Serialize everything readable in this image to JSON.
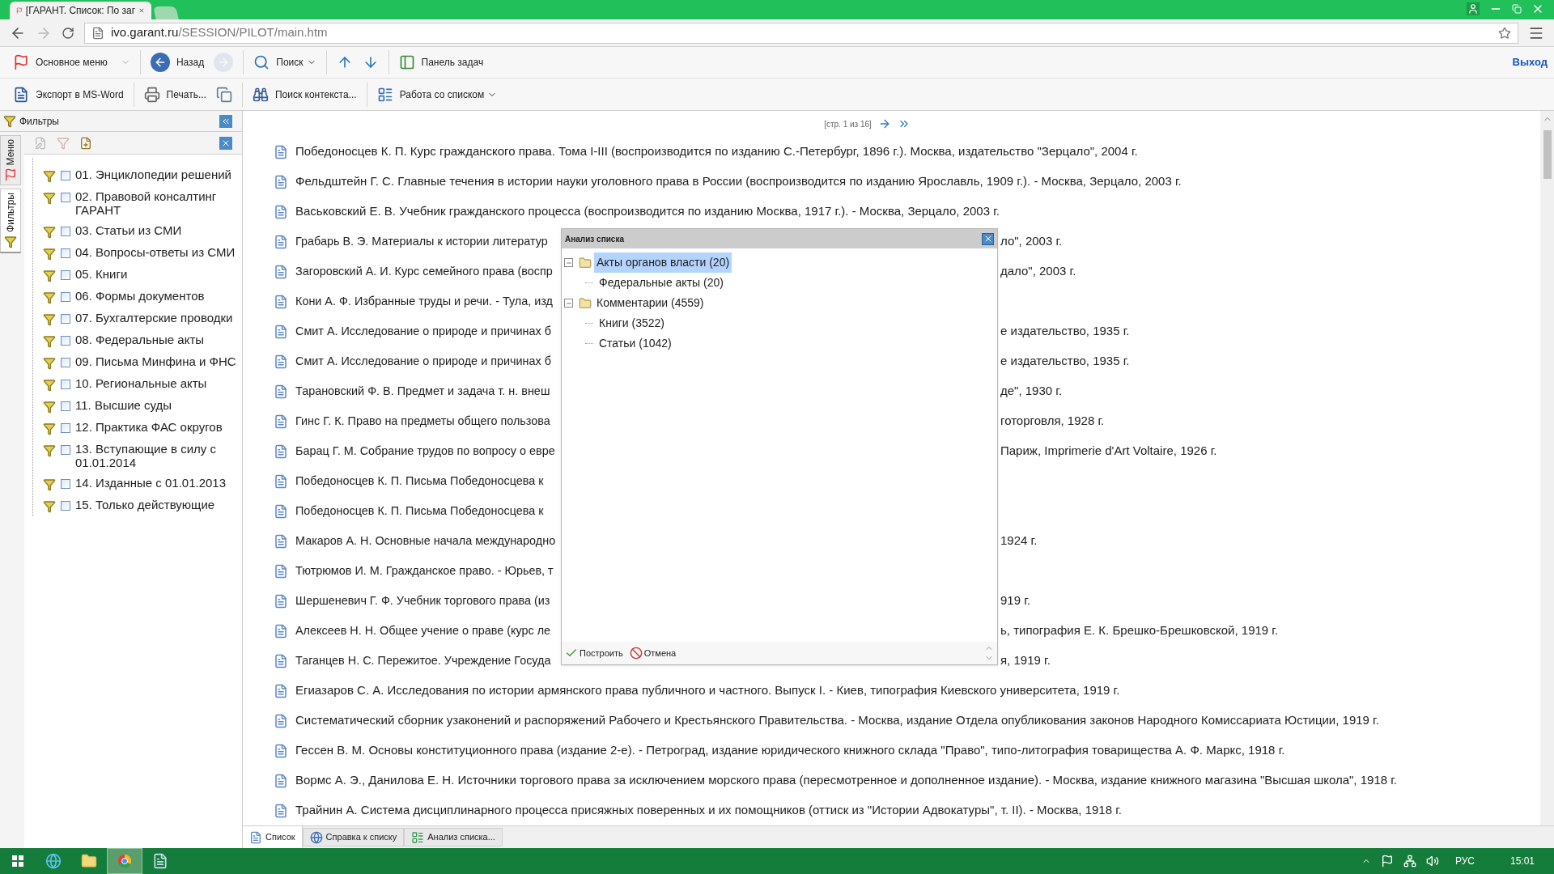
{
  "browser": {
    "tab_title": "[ГАРАНТ. Список: По заг",
    "url_host": "ivo.garant.ru",
    "url_path": "/SESSION/PILOT/main.htm"
  },
  "toolbar_main": [
    [
      {
        "label": "Основное меню",
        "kind": "menu",
        "disabled": false
      }
    ],
    [
      {
        "label": "Назад",
        "kind": "button",
        "disabled": false
      },
      {
        "kind": "icon",
        "disabled": true
      }
    ],
    [
      {
        "label": "Поиск",
        "kind": "menu",
        "disabled": false
      }
    ],
    [
      {
        "kind": "icon",
        "disabled": false
      },
      {
        "kind": "icon",
        "disabled": false
      }
    ],
    [
      {
        "label": "Панель задач",
        "kind": "button",
        "disabled": false
      }
    ]
  ],
  "exit_link": "Выход",
  "toolbar_doc": [
    [
      {
        "label": "Экспорт в MS-Word",
        "kind": "button",
        "disabled": false
      }
    ],
    [
      {
        "label": "Печать...",
        "kind": "button",
        "disabled": false
      },
      {
        "kind": "icon",
        "disabled": false
      }
    ],
    [
      {
        "label": "Поиск контекста...",
        "kind": "button",
        "disabled": false
      }
    ],
    [
      {
        "label": "Работа со списком",
        "kind": "menu",
        "disabled": false
      }
    ]
  ],
  "sidebar": {
    "title": "Фильтры",
    "vertical_tabs": [
      {
        "label": "Меню",
        "selected": false
      },
      {
        "label": "Фильтры",
        "selected": true
      }
    ],
    "filters": [
      {
        "label": "01. Энциклопедии решений",
        "checked": false
      },
      {
        "label": "02. Правовой консалтинг ГАРАНТ",
        "checked": false
      },
      {
        "label": "03. Статьи из СМИ",
        "checked": false
      },
      {
        "label": "04. Вопросы-ответы из СМИ",
        "checked": false
      },
      {
        "label": "05. Книги",
        "checked": false
      },
      {
        "label": "06. Формы документов",
        "checked": false
      },
      {
        "label": "07. Бухгалтерские проводки",
        "checked": false
      },
      {
        "label": "08. Федеральные акты",
        "checked": false
      },
      {
        "label": "09. Письма Минфина и ФНС",
        "checked": false
      },
      {
        "label": "10. Региональные акты",
        "checked": false
      },
      {
        "label": "11. Высшие суды",
        "checked": false
      },
      {
        "label": "12. Практика ФАС округов",
        "checked": false
      },
      {
        "label": "13. Вступающие в силу с 01.01.2014",
        "checked": false
      },
      {
        "label": "14. Изданные с 01.01.2013",
        "checked": false
      },
      {
        "label": "15. Только действующие",
        "checked": false
      }
    ]
  },
  "pager": "[стр. 1 из 16]",
  "documents": [
    {
      "kind": "full",
      "text": "Победоносцев К. П. Курс гражданского права. Тома I-III (воспроизводится по изданию С.-Петербург, 1896 г.). Москва, издательство \"Зерцало\", 2004 г."
    },
    {
      "kind": "full",
      "text": "Фельдштейн Г. С. Главные течения в истории науки уголовного права в России (воспроизводится по изданию Ярославль, 1909 г.). - Москва, Зерцало, 2003 г."
    },
    {
      "kind": "full",
      "text": "Васьковский Е. В. Учебник гражданского процесса (воспроизводится по изданию Москва, 1917 г.). - Москва, Зерцало, 2003 г."
    },
    {
      "kind": "covered",
      "text_left": "Грабарь В. Э. Материалы к истории литератур",
      "text_right": "ло\", 2003 г."
    },
    {
      "kind": "covered",
      "text_left": "Загоровский А. И. Курс семейного права (воспр",
      "text_right": "дало\", 2003 г."
    },
    {
      "kind": "covered",
      "text_left": "Кони А. Ф. Избранные труды и речи. - Тула, изд"
    },
    {
      "kind": "covered",
      "text_left": "Смит А. Исследование о природе и причинах б",
      "text_right": "е издательство, 1935 г."
    },
    {
      "kind": "covered",
      "text_left": "Смит А. Исследование о природе и причинах б",
      "text_right": "е издательство, 1935 г."
    },
    {
      "kind": "covered",
      "text_left": "Тарановский Ф. В. Предмет и задача т. н. внеш",
      "text_right": "де\", 1930 г."
    },
    {
      "kind": "covered",
      "text_left": "Гинс Г. К. Право на предметы общего пользова",
      "text_right": "готорговля, 1928 г."
    },
    {
      "kind": "covered",
      "text_left": "Барац Г. М. Собрание трудов по вопросу о евре",
      "text_right": "Париж, Imprimerie d'Art Voltaire, 1926 г."
    },
    {
      "kind": "covered",
      "text_left": "Победоносцев К. П. Письма Победоносцева к"
    },
    {
      "kind": "covered",
      "text_left": "Победоносцев К. П. Письма Победоносцева к"
    },
    {
      "kind": "covered",
      "text_left": "Макаров А. Н. Основные начала международно",
      "text_right": "1924 г."
    },
    {
      "kind": "covered",
      "text_left": "Тютрюмов И. М. Гражданское право. - Юрьев, т"
    },
    {
      "kind": "covered",
      "text_left": "Шершеневич Г. Ф. Учебник торгового права (из",
      "text_right": "919 г."
    },
    {
      "kind": "covered",
      "text_left": "Алексеев Н. Н. Общее учение о праве (курс ле",
      "text_right": "ь, типография Е. К. Брешко-Брешковской, 1919 г."
    },
    {
      "kind": "covered",
      "text_left": "Таганцев Н. С. Пережитое. Учреждение Госуда",
      "text_right": "я, 1919 г."
    },
    {
      "kind": "full",
      "text": "Егиазаров С. А. Исследования по истории армянского права публичного и частного. Выпуск I. - Киев, типография Киевского университета, 1919 г."
    },
    {
      "kind": "full",
      "text": "Систематический сборник узаконений и распоряжений Рабочего и Крестьянского Правительства. - Москва, издание Отдела опубликования законов Народного Комиссариата Юстиции, 1919 г."
    },
    {
      "kind": "full",
      "text": "Гессен В. М. Основы конституционного права (издание 2-е). - Петроград, издание юридического книжного склада \"Право\", типо-литография товарищества А. Ф. Маркс, 1918 г."
    },
    {
      "kind": "full",
      "text": "Вормс А. Э., Данилова Е. Н. Источники торгового права за исключением морского права (пересмотренное и дополненное издание). - Москва, издание книжного магазина \"Высшая школа\", 1918 г."
    },
    {
      "kind": "full",
      "text": "Трайнин А. Система дисциплинарного процесса присяжных поверенных и их помощников (оттиск из \"Истории Адвокатуры\", т. II). - Москва, 1918 г."
    }
  ],
  "dialog": {
    "title": "Анализ списка",
    "tree": [
      {
        "label": "Акты органов власти (20)",
        "selected": true,
        "expanded": true,
        "children": [
          {
            "label": "Федеральные акты (20)"
          }
        ]
      },
      {
        "label": "Комментарии (4559)",
        "selected": false,
        "expanded": true,
        "children": [
          {
            "label": "Книги (3522)"
          },
          {
            "label": "Статьи (1042)"
          }
        ]
      }
    ],
    "buttons": [
      {
        "label": "Построить",
        "kind": "ok"
      },
      {
        "label": "Отмена",
        "kind": "cancel"
      }
    ]
  },
  "bottom_tabs": [
    {
      "label": "Список",
      "selected": true
    },
    {
      "label": "Справка к списку",
      "selected": false
    },
    {
      "label": "Анализ списка...",
      "selected": false
    }
  ],
  "taskbar": {
    "apps": [
      {
        "selected": false
      },
      {
        "selected": false
      },
      {
        "selected": false
      },
      {
        "selected": true
      },
      {
        "selected": false
      }
    ],
    "language": "РУС",
    "clock": "15:01"
  }
}
